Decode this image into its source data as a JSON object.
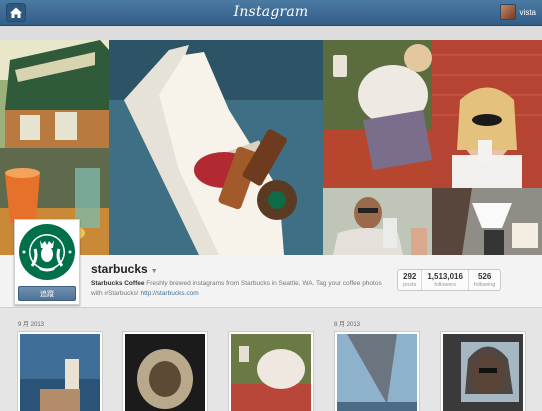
{
  "header": {
    "brand": "Instagram",
    "username": "vista"
  },
  "profile": {
    "name": "starbucks",
    "follow_label": "追蹤",
    "bio_name": "Starbucks Coffee",
    "bio_text": " Freshly brewed instagrams from Starbucks in Seattle, WA. Tag your coffee photos with #Starbucks! ",
    "bio_link": "http://starbucks.com",
    "stats": [
      {
        "value": "292",
        "label": "posts"
      },
      {
        "value": "1,513,016",
        "label": "followers"
      },
      {
        "value": "526",
        "label": "following"
      }
    ]
  },
  "feed": {
    "months": [
      "9 月 2013",
      "8 月 2013"
    ]
  },
  "colors": {
    "topbar": "#3f6a93",
    "starbucks_green": "#00704a",
    "link": "#3f729b"
  },
  "icons": [
    "home-icon",
    "caret-down-icon"
  ]
}
